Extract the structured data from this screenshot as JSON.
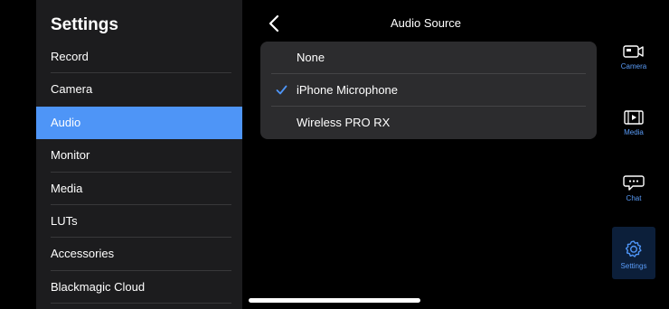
{
  "sidebar": {
    "title": "Settings",
    "items": [
      {
        "label": "Record"
      },
      {
        "label": "Camera"
      },
      {
        "label": "Audio",
        "active": true
      },
      {
        "label": "Monitor"
      },
      {
        "label": "Media"
      },
      {
        "label": "LUTs"
      },
      {
        "label": "Accessories"
      },
      {
        "label": "Blackmagic Cloud"
      }
    ]
  },
  "header": {
    "title": "Audio Source",
    "back_icon": "chevron-left-icon"
  },
  "audio_source": {
    "options": [
      {
        "label": "None",
        "selected": false
      },
      {
        "label": "iPhone Microphone",
        "selected": true
      },
      {
        "label": "Wireless PRO RX",
        "selected": false
      }
    ],
    "check_icon": "checkmark-icon"
  },
  "tabbar": {
    "tabs": [
      {
        "label": "Camera",
        "icon": "camera-icon"
      },
      {
        "label": "Media",
        "icon": "film-icon"
      },
      {
        "label": "Chat",
        "icon": "chat-bubble-icon"
      },
      {
        "label": "Settings",
        "icon": "gear-icon",
        "active": true
      }
    ]
  },
  "colors": {
    "accent": "#4e95f7",
    "sidebar_bg": "#1c1c1e",
    "card_bg": "#2c2c2e",
    "tab_label": "#5a9cf8"
  }
}
